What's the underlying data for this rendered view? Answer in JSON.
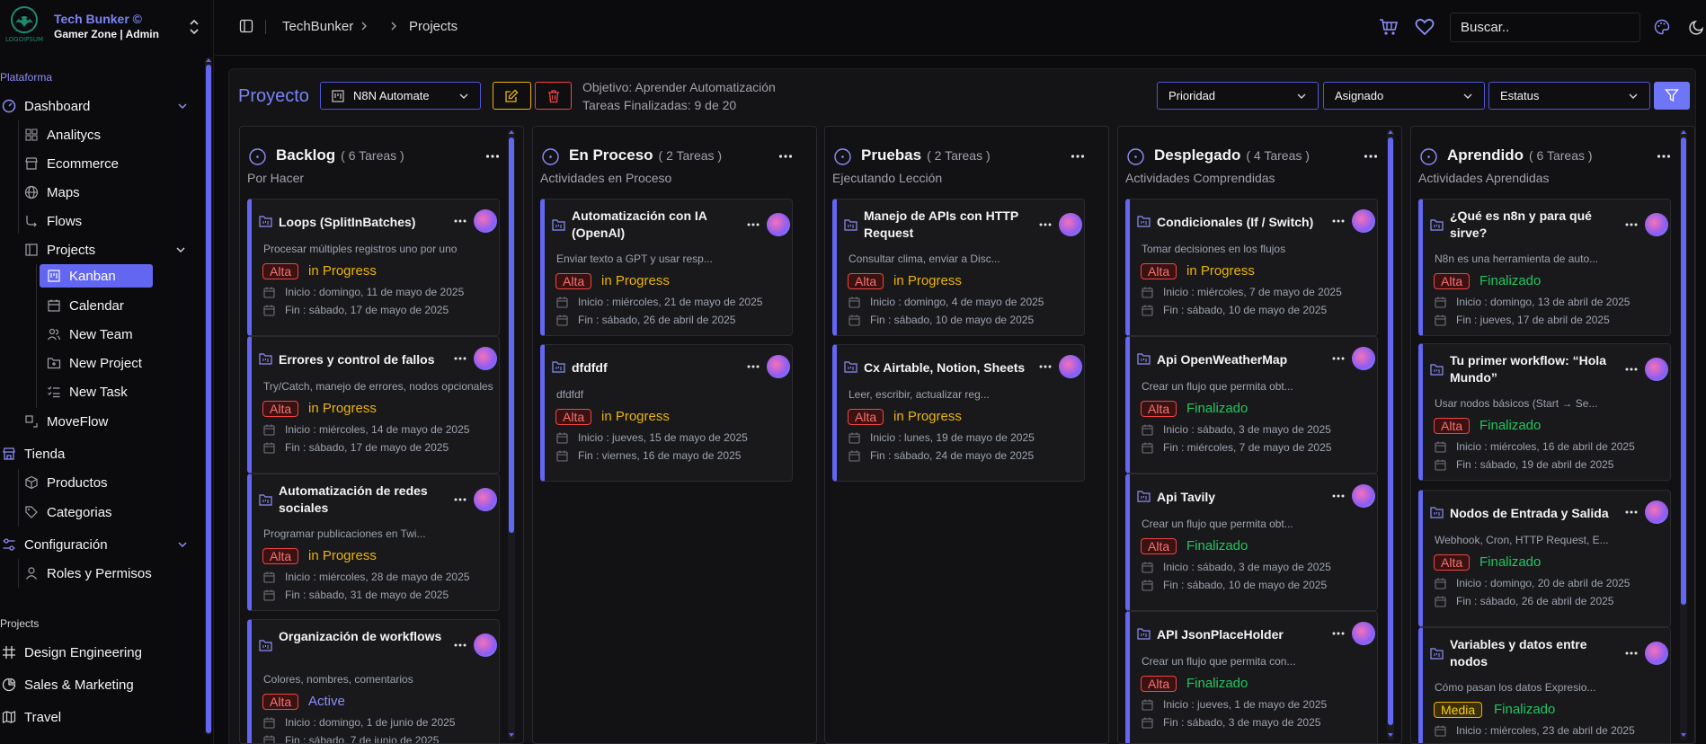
{
  "brand": {
    "name": "Tech Bunker ©",
    "sub": "Gamer Zone | Admin"
  },
  "sidebar": {
    "section_platform": "Plataforma",
    "dashboard": "Dashboard",
    "dashboard_items": [
      "Analitycs",
      "Ecommerce",
      "Maps",
      "Flows"
    ],
    "projects": "Projects",
    "project_items": [
      "Kanban",
      "Calendar",
      "New Team",
      "New Project",
      "New Task"
    ],
    "moveflow": "MoveFlow",
    "tienda": "Tienda",
    "tienda_items": [
      "Productos",
      "Categorias"
    ],
    "config": "Configuración",
    "config_items": [
      "Roles y Permisos"
    ],
    "section_projects": "Projects",
    "bottom_items": [
      "Design Engineering",
      "Sales & Marketing",
      "Travel"
    ]
  },
  "topbar": {
    "breadcrumb": [
      "TechBunker",
      "Projects"
    ],
    "search_placeholder": "Buscar.."
  },
  "toolbar": {
    "title": "Proyecto",
    "project_select": "N8N Automate",
    "objective": "Objetivo: Aprender Automatización",
    "finished": "Tareas Finalizadas: 9 de 20",
    "filters": [
      "Prioridad",
      "Asignado",
      "Estatus"
    ]
  },
  "colors": {
    "accent": "#6366f1",
    "alta": "#ef4444",
    "media": "#eab308",
    "in_progress": "#eab308",
    "finalizado": "#22c55e"
  },
  "columns": [
    {
      "title": "Backlog",
      "count": "( 6 Tareas )",
      "subtitle": "Por Hacer",
      "cards": [
        {
          "title": "Loops (SplitInBatches)",
          "desc": "Procesar múltiples registros uno por uno",
          "priority": "Alta",
          "status": "in Progress",
          "start": "Inicio : domingo, 11 de mayo de 2025",
          "end": "Fin : sábado, 17 de mayo de 2025"
        },
        {
          "title": "Errores y control de fallos",
          "desc": "Try/Catch, manejo de errores, nodos opcionales",
          "priority": "Alta",
          "status": "in Progress",
          "start": "Inicio : miércoles, 14 de mayo de 2025",
          "end": "Fin : sábado, 17 de mayo de 2025"
        },
        {
          "title": "Automatización de redes sociales",
          "desc": "Programar publicaciones en Twi...",
          "priority": "Alta",
          "status": "in Progress",
          "start": "Inicio : miércoles, 28 de mayo de 2025",
          "end": "Fin : sábado, 31 de mayo de 2025"
        },
        {
          "title": "Organización de workflows",
          "desc": "Colores, nombres, comentarios",
          "priority": "Alta",
          "status": "Active",
          "start": "Inicio : domingo, 1 de junio de 2025",
          "end": "Fin : sábado, 7 de junio de 2025"
        }
      ]
    },
    {
      "title": "En Proceso",
      "count": "( 2 Tareas )",
      "subtitle": "Actividades en Proceso",
      "cards": [
        {
          "title": "Automatización con IA (OpenAI)",
          "desc": "Enviar texto a GPT y usar resp...",
          "priority": "Alta",
          "status": "in Progress",
          "start": "Inicio : miércoles, 21 de mayo de 2025",
          "end": "Fin : sábado, 26 de abril de 2025"
        },
        {
          "title": "dfdfdf",
          "desc": "dfdfdf",
          "priority": "Alta",
          "status": "in Progress",
          "start": "Inicio : jueves, 15 de mayo de 2025",
          "end": "Fin : viernes, 16 de mayo de 2025"
        }
      ]
    },
    {
      "title": "Pruebas",
      "count": "( 2 Tareas )",
      "subtitle": "Ejecutando Lección",
      "cards": [
        {
          "title": "Manejo de APIs con HTTP Request",
          "desc": "Consultar clima, enviar a Disc...",
          "priority": "Alta",
          "status": "in Progress",
          "start": "Inicio : domingo, 4 de mayo de 2025",
          "end": "Fin : sábado, 10 de mayo de 2025"
        },
        {
          "title": "Cx Airtable, Notion, Sheets",
          "desc": "Leer, escribir, actualizar reg...",
          "priority": "Alta",
          "status": "in Progress",
          "start": "Inicio : lunes, 19 de mayo de 2025",
          "end": "Fin : sábado, 24 de mayo de 2025"
        }
      ]
    },
    {
      "title": "Desplegado",
      "count": "( 4 Tareas )",
      "subtitle": "Actividades Comprendidas",
      "cards": [
        {
          "title": "Condicionales (If / Switch)",
          "desc": "Tomar decisiones en los flujos",
          "priority": "Alta",
          "status": "in Progress",
          "start": "Inicio : miércoles, 7 de mayo de 2025",
          "end": "Fin : sábado, 10 de mayo de 2025"
        },
        {
          "title": "Api OpenWeatherMap",
          "desc": "Crear un flujo que permita obt...",
          "priority": "Alta",
          "status": "Finalizado",
          "start": "Inicio : sábado, 3 de mayo de 2025",
          "end": "Fin : miércoles, 7 de mayo de 2025"
        },
        {
          "title": "Api Tavily",
          "desc": "Crear un flujo que permita obt...",
          "priority": "Alta",
          "status": "Finalizado",
          "start": "Inicio : sábado, 3 de mayo de 2025",
          "end": "Fin : sábado, 10 de mayo de 2025"
        },
        {
          "title": "API JsonPlaceHolder",
          "desc": "Crear un flujo que permita con...",
          "priority": "Alta",
          "status": "Finalizado",
          "start": "Inicio : jueves, 1 de mayo de 2025",
          "end": "Fin : sábado, 3 de mayo de 2025"
        }
      ]
    },
    {
      "title": "Aprendido",
      "count": "( 6 Tareas )",
      "subtitle": "Actividades Aprendidas",
      "cards": [
        {
          "title": "¿Qué es n8n y para qué sirve?",
          "desc": "N8n es una herramienta de auto...",
          "priority": "Alta",
          "status": "Finalizado",
          "start": "Inicio : domingo, 13 de abril de 2025",
          "end": "Fin : jueves, 17 de abril de 2025"
        },
        {
          "title": "Tu primer workflow: “Hola Mundo”",
          "desc": "Usar nodos básicos (Start → Se...",
          "priority": "Alta",
          "status": "Finalizado",
          "start": "Inicio : miércoles, 16 de abril de 2025",
          "end": "Fin : sábado, 19 de abril de 2025"
        },
        {
          "title": "Nodos de Entrada y Salida",
          "desc": "Webhook, Cron, HTTP Request, E...",
          "priority": "Alta",
          "status": "Finalizado",
          "start": "Inicio : domingo, 20 de abril de 2025",
          "end": "Fin : sábado, 26 de abril de 2025"
        },
        {
          "title": "Variables y datos entre nodos",
          "desc": "Cómo pasan los datos Expresio...",
          "priority": "Media",
          "status": "Finalizado",
          "start": "Inicio : miércoles, 23 de abril de 2025",
          "end": ""
        }
      ]
    }
  ]
}
